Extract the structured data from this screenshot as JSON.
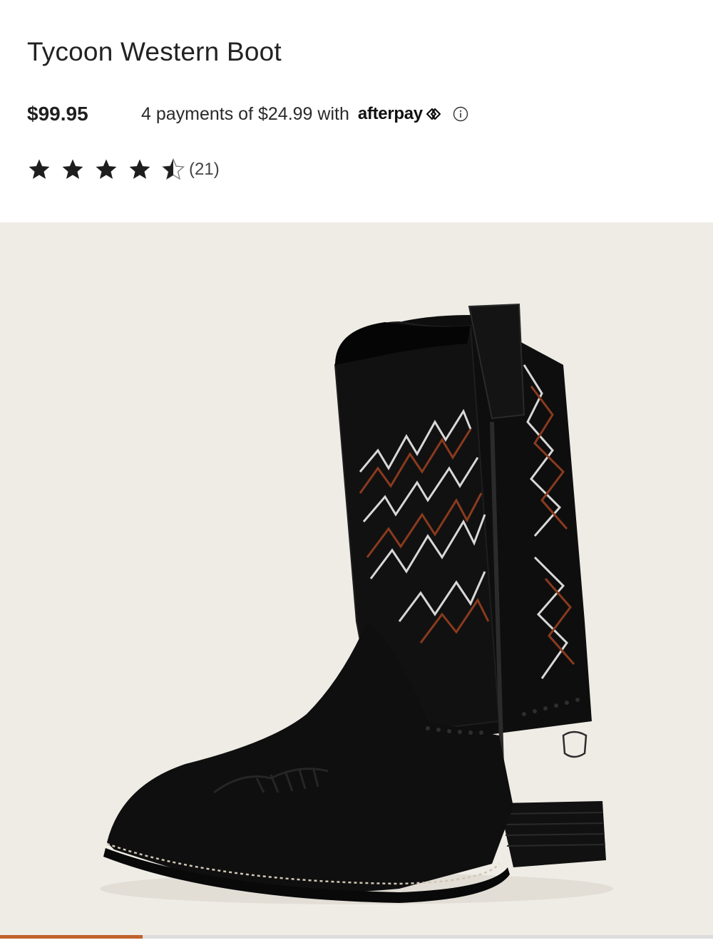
{
  "product": {
    "title": "Tycoon Western Boot",
    "price": "$99.95",
    "installments_text": "4 payments of $24.99 with",
    "installments_provider": "afterpay",
    "rating": 4.5,
    "rating_max": 5,
    "review_count": "(21)"
  },
  "gallery": {
    "progress": 0.2,
    "progress_color": "#c0622e",
    "background_color": "#efece6"
  },
  "icons": {
    "star": "star-icon",
    "half_star": "half-star-icon",
    "afterpay_logo": "afterpay-arrows-icon",
    "info": "info-icon"
  }
}
